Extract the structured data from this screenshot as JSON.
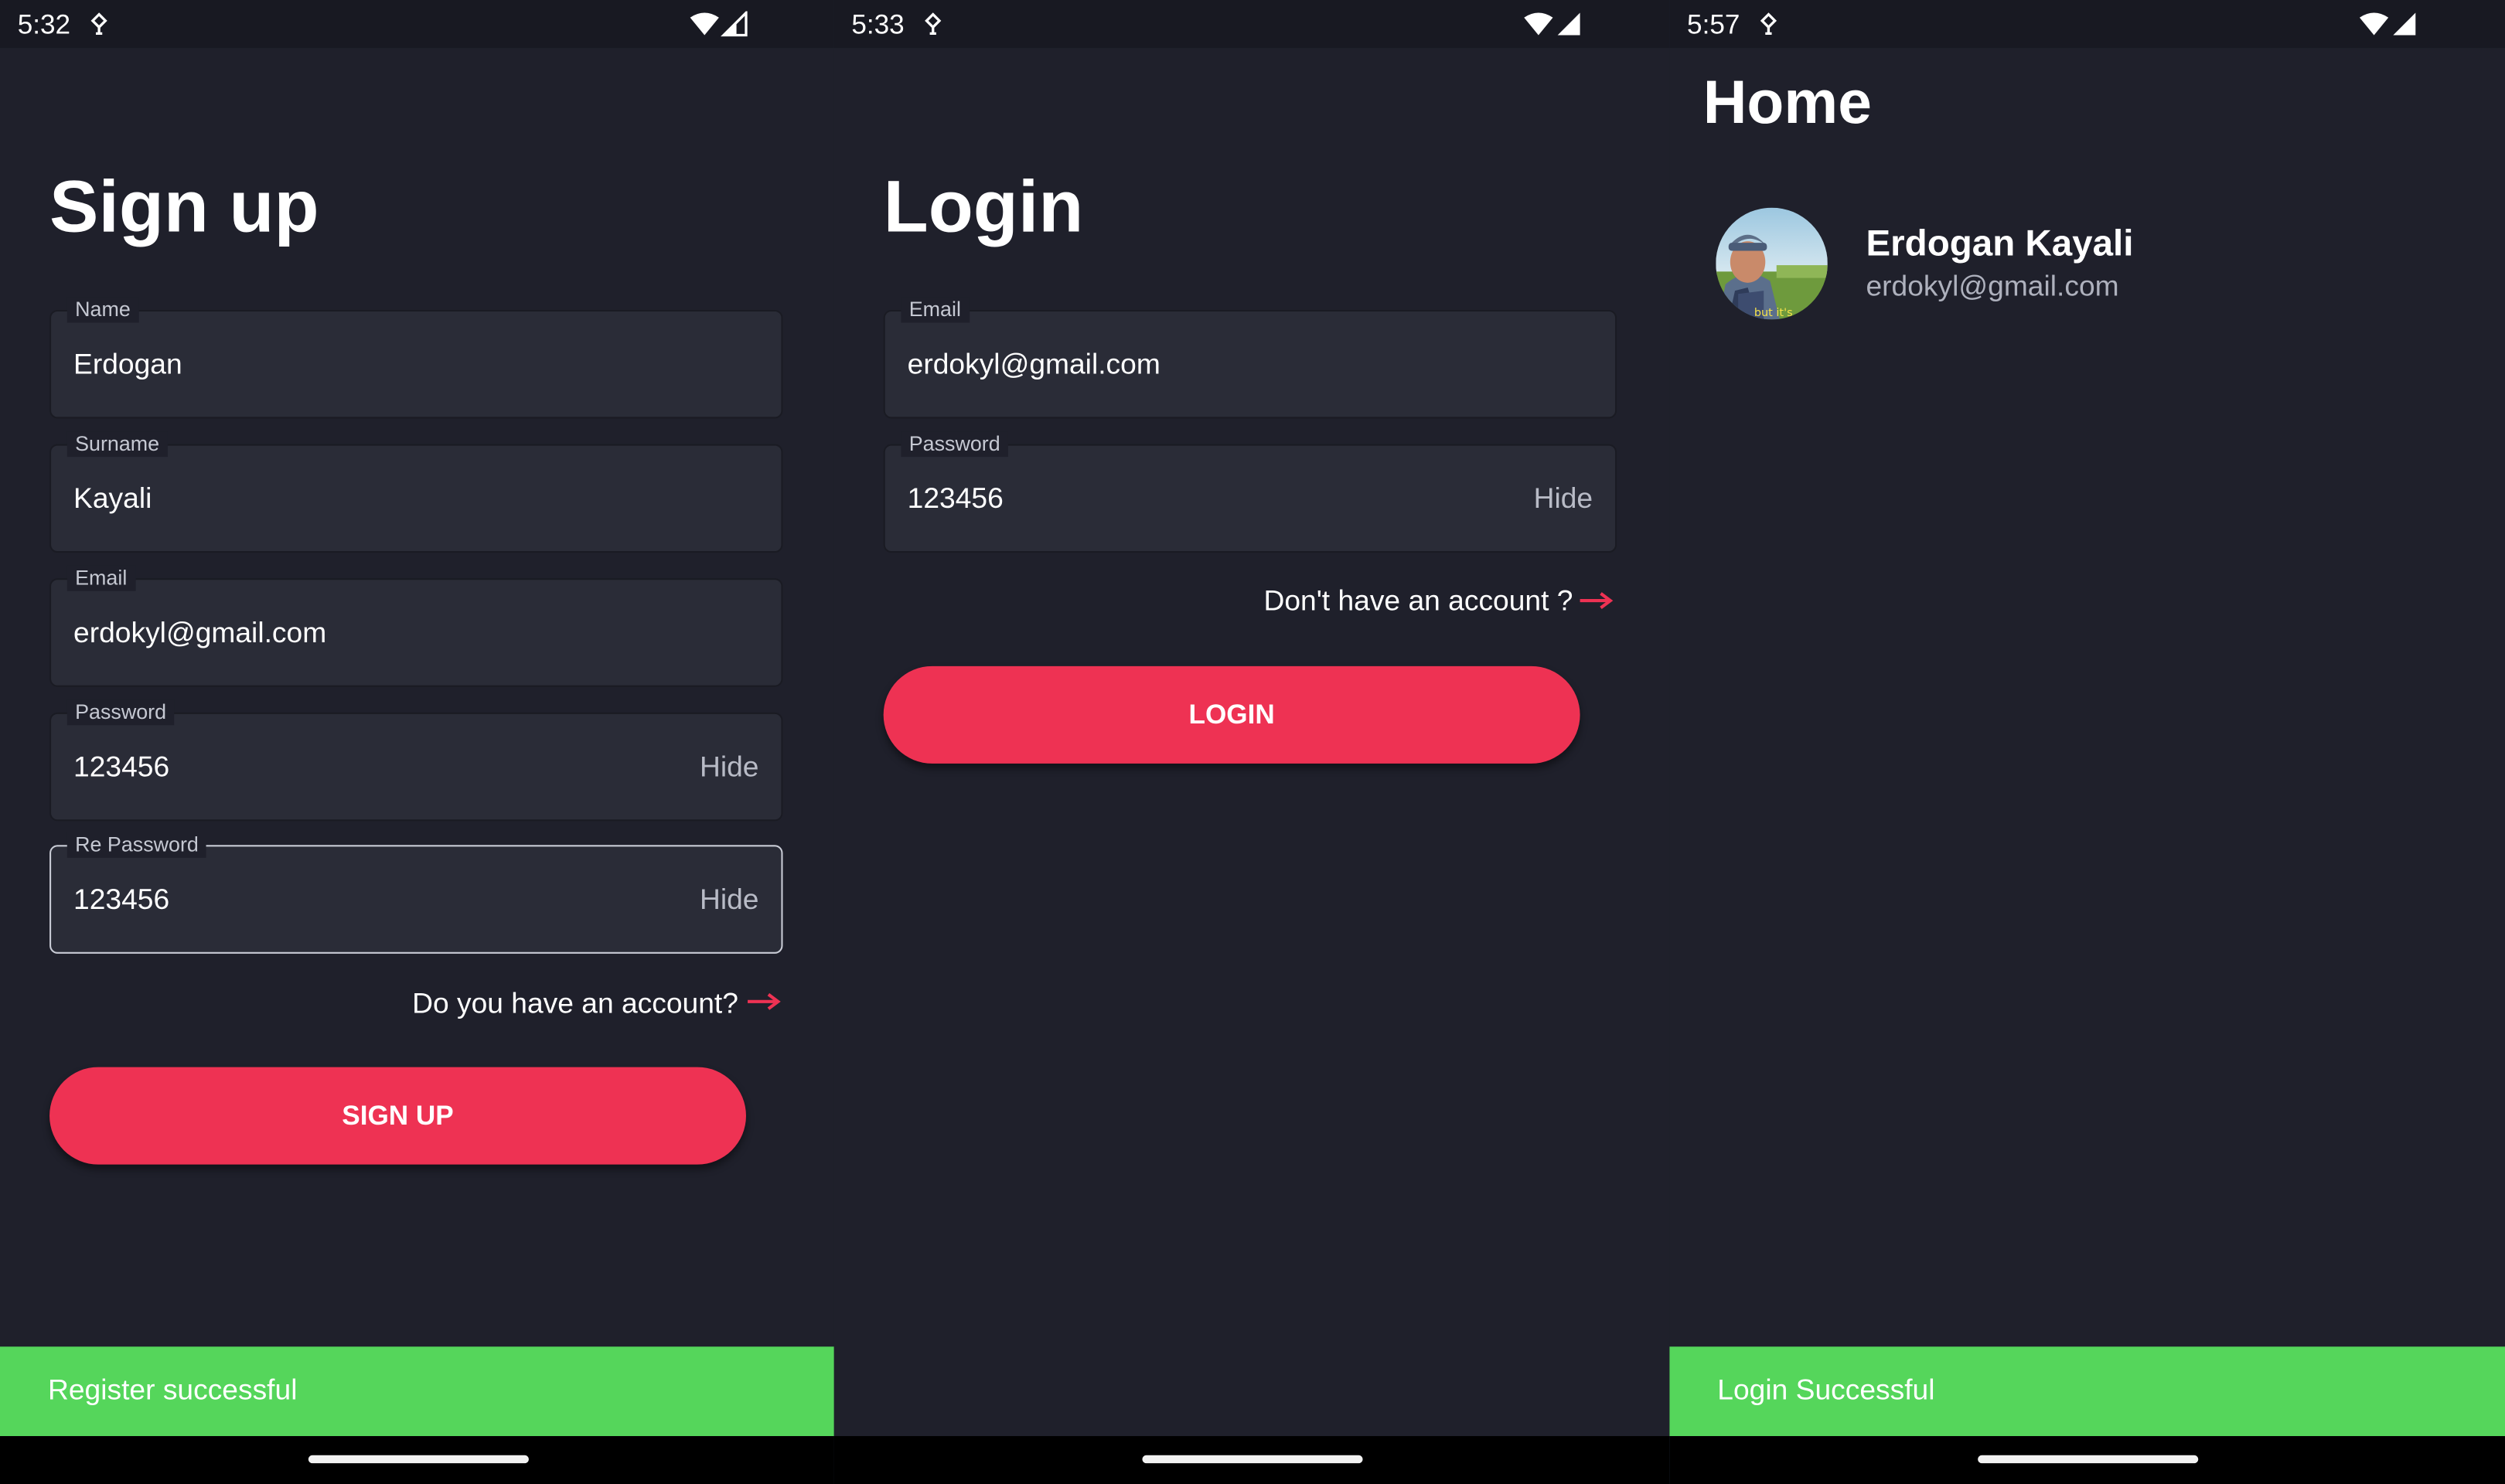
{
  "signup": {
    "status": {
      "time": "5:32"
    },
    "title": "Sign up",
    "fields": {
      "name": {
        "label": "Name",
        "value": "Erdogan"
      },
      "surname": {
        "label": "Surname",
        "value": "Kayali"
      },
      "email": {
        "label": "Email",
        "value": "erdokyl@gmail.com"
      },
      "password": {
        "label": "Password",
        "value": "123456",
        "action": "Hide"
      },
      "repassword": {
        "label": "Re Password",
        "value": "123456",
        "action": "Hide"
      }
    },
    "account_link": "Do you have an account?",
    "button": "SIGN UP",
    "snackbar": "Register successful"
  },
  "login": {
    "status": {
      "time": "5:33"
    },
    "title": "Login",
    "fields": {
      "email": {
        "label": "Email",
        "value": "erdokyl@gmail.com"
      },
      "password": {
        "label": "Password",
        "value": "123456",
        "action": "Hide"
      }
    },
    "account_link": "Don't have an account ?",
    "button": "LOGIN"
  },
  "home": {
    "status": {
      "time": "5:57"
    },
    "title": "Home",
    "user": {
      "name": "Erdogan Kayali",
      "email": "erdokyl@gmail.com",
      "avatar_caption": "but it's"
    },
    "snackbar": "Login Successful"
  },
  "colors": {
    "background": "#1f202b",
    "field_background": "#2a2c37",
    "accent": "#ee3253",
    "success": "#55d65b"
  },
  "icons": {
    "status_extra": "vpn-key-icon",
    "wifi": "wifi-icon",
    "signal": "cell-signal-icon",
    "arrow": "arrow-right-icon"
  }
}
